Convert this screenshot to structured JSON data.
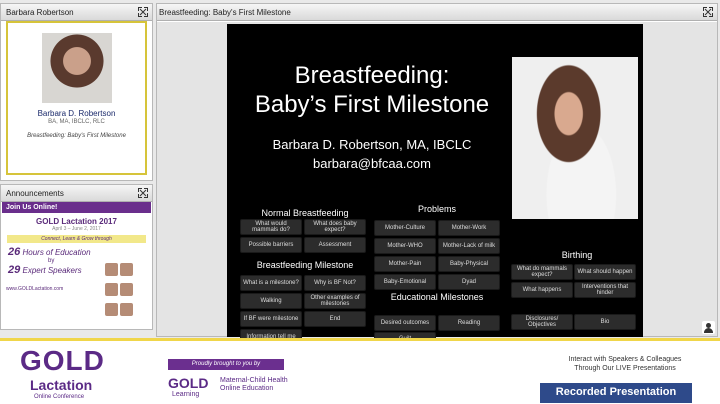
{
  "presenter_panel": {
    "title": "Barbara Robertson",
    "name": "Barbara D. Robertson",
    "credentials": "BA, MA, IBCLC, RLC",
    "talk": "Breastfeeding: Baby's First Milestone"
  },
  "announcements": {
    "title": "Announcements",
    "join": "Join Us Online!",
    "ad_title": "GOLD Lactation 2017",
    "ad_dates": "April 3 – June 2, 2017",
    "ad_tagline": "Connect, Learn & Grow through",
    "hours_num": "26",
    "hours_text": "Hours of Education",
    "by": "by",
    "speakers_num": "29",
    "speakers_text": "Expert Speakers",
    "url": "www.GOLDLactation.com"
  },
  "slide_panel": {
    "title": "Breastfeeding: Baby's First Milestone"
  },
  "slide": {
    "title_line1": "Breastfeeding:",
    "title_line2": "Baby’s First Milestone",
    "author": "Barbara D. Robertson, MA, IBCLC",
    "email": "barbara@bfcaa.com",
    "sections": {
      "normal": "Normal Breastfeeding",
      "problems": "Problems",
      "milestone": "Breastfeeding Milestone",
      "educational": "Educational Milestones",
      "birthing": "Birthing"
    },
    "normal_buttons": [
      "What would mammals do?",
      "What does baby expect?",
      "Possible barriers",
      "Assessment"
    ],
    "milestone_buttons": [
      "What is a milestone?",
      "Why is BF Not?",
      "Walking",
      "Other examples of milestones",
      "If BF were milestone",
      "End",
      "Information tell me"
    ],
    "problem_buttons": [
      "Mother-Culture",
      "Mother-Work",
      "Mother-WHO",
      "Mother-Lack of milk",
      "Mother-Pain",
      "Baby-Physical",
      "Baby-Emotional",
      "Dyad"
    ],
    "educational_buttons": [
      "Desired outcomes",
      "Reading",
      "Guilt"
    ],
    "birthing_buttons": [
      "What do mammals expect?",
      "What should happen",
      "What happens",
      "Interventions that hinder",
      "Disclosures/ Objectives",
      "Bio"
    ]
  },
  "footer": {
    "gold": "GOLD",
    "lactation": "Lactation",
    "conference": "Online Conference",
    "brought_by": "Proudly brought to you by",
    "gold_learning": "GOLD",
    "learning": "Learning",
    "mch_line1": "Maternal-Child Health",
    "mch_line2": "Online Education",
    "interact_line1": "Interact with Speakers & Colleagues",
    "interact_line2": "Through Our LIVE Presentations",
    "recorded": "Recorded Presentation"
  },
  "colors": {
    "brand_purple": "#5b2a86",
    "brand_gold": "#e2b93b",
    "recorded_blue": "#2e4a8a"
  }
}
